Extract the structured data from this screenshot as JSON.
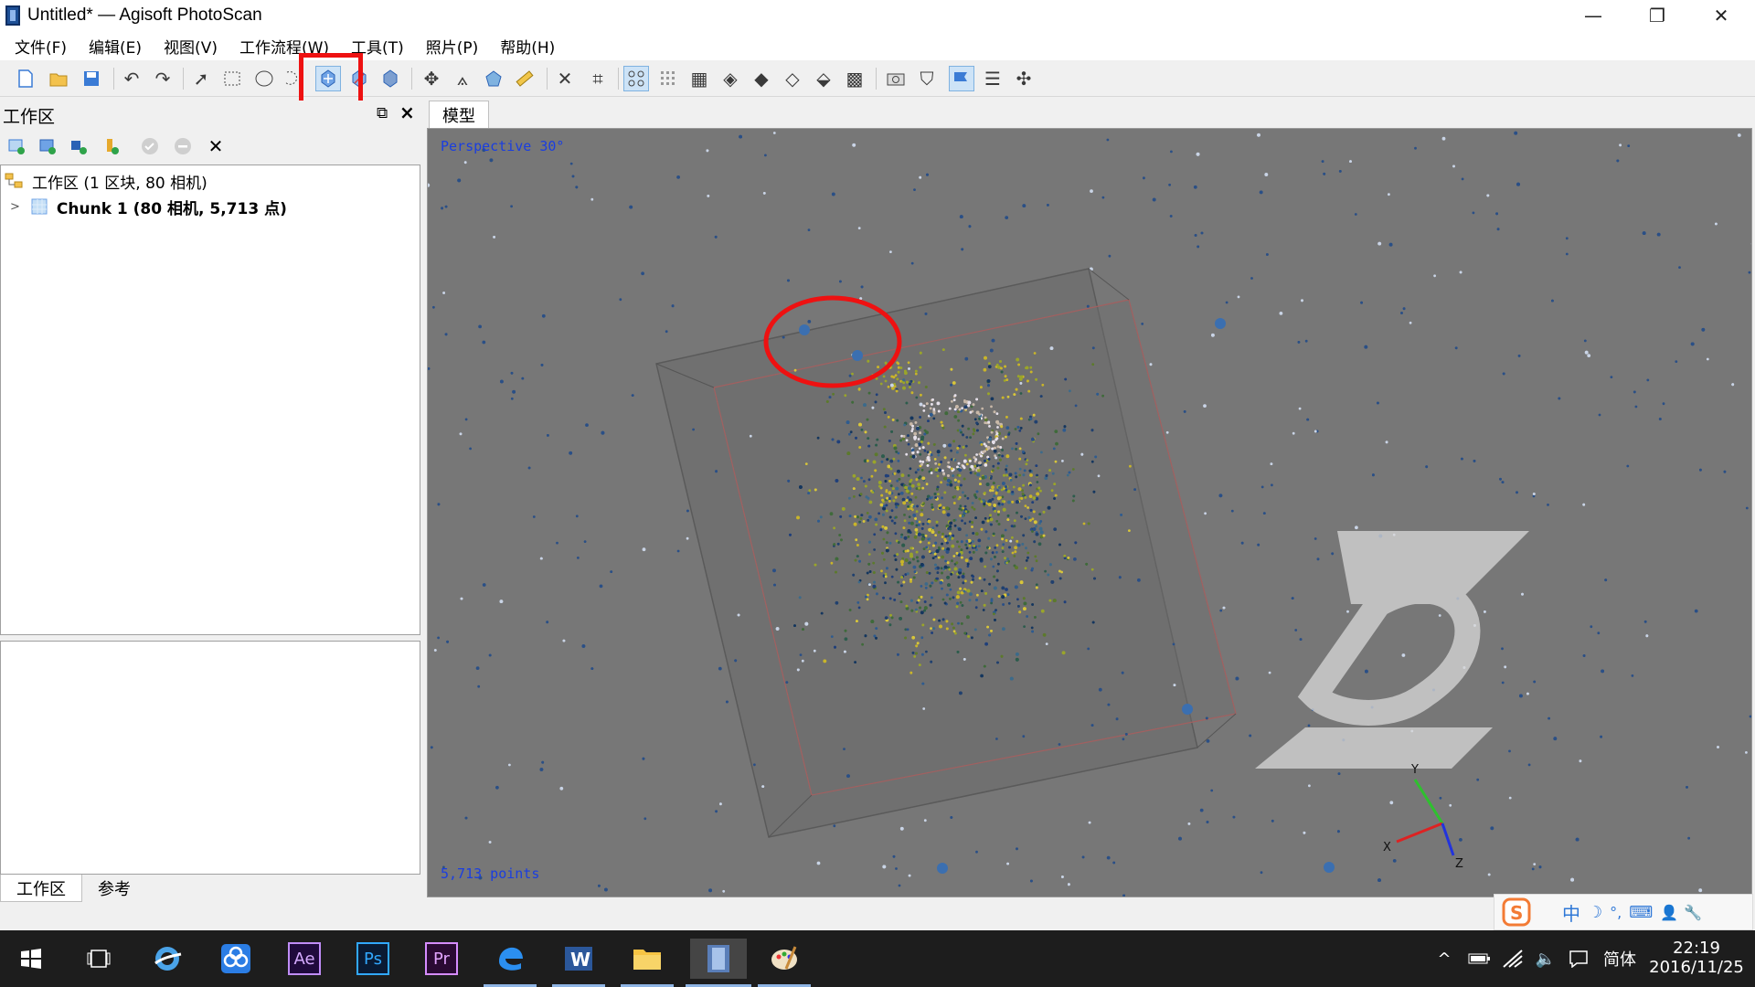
{
  "window": {
    "title": "Untitled* — Agisoft PhotoScan",
    "controls": [
      "minimize-icon",
      "restore-icon",
      "close-icon"
    ]
  },
  "menu": [
    "文件(F)",
    "编辑(E)",
    "视图(V)",
    "工作流程(W)",
    "工具(T)",
    "照片(P)",
    "帮助(H)"
  ],
  "workspace": {
    "title": "工作区",
    "root_label": "工作区 (1 区块, 80 相机)",
    "chunk_label": "Chunk 1 (80 相机, 5,713 点)",
    "tabs": [
      "工作区",
      "参考"
    ]
  },
  "model": {
    "tab_label": "模型",
    "perspective_label": "Perspective 30°",
    "points_label": "5,713 points",
    "axes": {
      "x": "X",
      "y": "Y",
      "z": "Z"
    },
    "colors": {
      "background": "#777777",
      "label": "#1a3ee0"
    }
  },
  "ime": {
    "items": [
      "中",
      "☽",
      "°,",
      "⌨",
      "👤",
      "🔧"
    ]
  },
  "taskbar": {
    "time": "22:19",
    "date": "2016/11/25",
    "lang": "简体",
    "apps": [
      "Ae",
      "Ps",
      "Pr"
    ]
  },
  "highlight_color": "#ee1111"
}
